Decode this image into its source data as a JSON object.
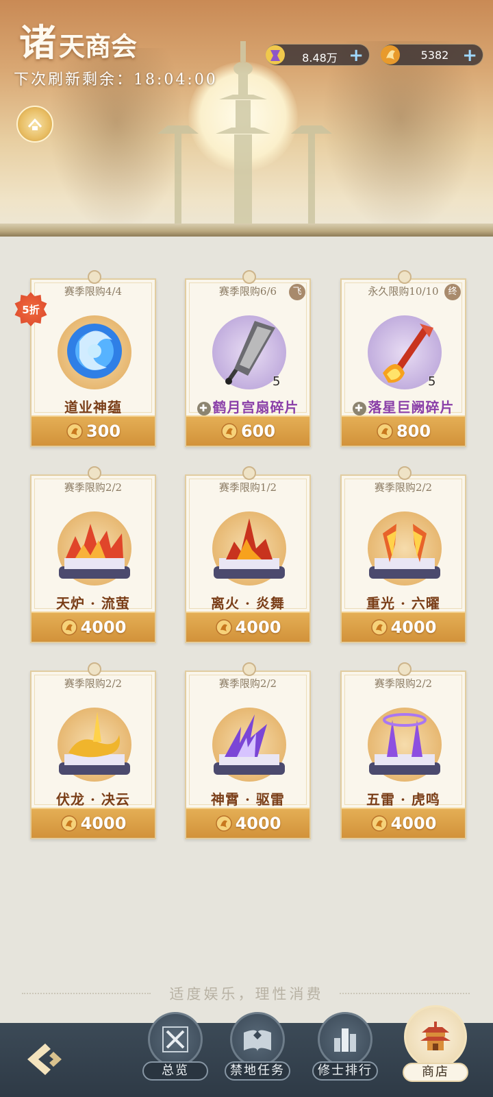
{
  "header": {
    "title_first": "诸",
    "title_rest": "天商会",
    "refresh_text": "下次刷新剩余：18:04:00"
  },
  "currencies": [
    {
      "icon": "purple-jade-icon",
      "value": "8.48万",
      "color": "#8e56c8"
    },
    {
      "icon": "gold-coin-icon",
      "value": "5382",
      "color": "#e89a2c"
    }
  ],
  "cards": [
    {
      "limit": "赛季限购4/4",
      "name": "道业神蕴",
      "price": "300",
      "qty": "",
      "tag": "",
      "badge": "5折",
      "style": "blue-orb",
      "name_color": "brown"
    },
    {
      "limit": "赛季限购6/6",
      "name": "鹤月宫扇碎片",
      "price": "600",
      "qty": "5",
      "tag": "飞",
      "badge": "",
      "style": "fan",
      "name_color": "purple"
    },
    {
      "limit": "永久限购10/10",
      "name": "落星巨阙碎片",
      "price": "800",
      "qty": "5",
      "tag": "终",
      "badge": "",
      "style": "sword",
      "name_color": "purple"
    },
    {
      "limit": "赛季限购2/2",
      "name": "天炉 · 流萤",
      "price": "4000",
      "qty": "",
      "tag": "",
      "badge": "",
      "style": "fire-scroll",
      "name_color": "brown"
    },
    {
      "limit": "赛季限购1/2",
      "name": "离火 · 炎舞",
      "price": "4000",
      "qty": "",
      "tag": "",
      "badge": "",
      "style": "flame-scroll",
      "name_color": "brown"
    },
    {
      "limit": "赛季限购2/2",
      "name": "重光 · 六曜",
      "price": "4000",
      "qty": "",
      "tag": "",
      "badge": "",
      "style": "arrow-scroll",
      "name_color": "brown"
    },
    {
      "limit": "赛季限购2/2",
      "name": "伏龙 · 决云",
      "price": "4000",
      "qty": "",
      "tag": "",
      "badge": "",
      "style": "dragon-scroll",
      "name_color": "brown"
    },
    {
      "limit": "赛季限购2/2",
      "name": "神霄 · 驱雷",
      "price": "4000",
      "qty": "",
      "tag": "",
      "badge": "",
      "style": "thunder-scroll",
      "name_color": "brown"
    },
    {
      "limit": "赛季限购2/2",
      "name": "五雷 · 虎鸣",
      "price": "4000",
      "qty": "",
      "tag": "",
      "badge": "",
      "style": "claw-scroll",
      "name_color": "brown"
    }
  ],
  "motto": "适度娱乐，理性消费",
  "nav": [
    {
      "label": "总览",
      "icon": "crossed-swords-icon"
    },
    {
      "label": "禁地任务",
      "icon": "book-icon"
    },
    {
      "label": "修士排行",
      "icon": "ranking-icon"
    },
    {
      "label": "商店",
      "icon": "shop-pavilion-icon",
      "active": true
    }
  ]
}
